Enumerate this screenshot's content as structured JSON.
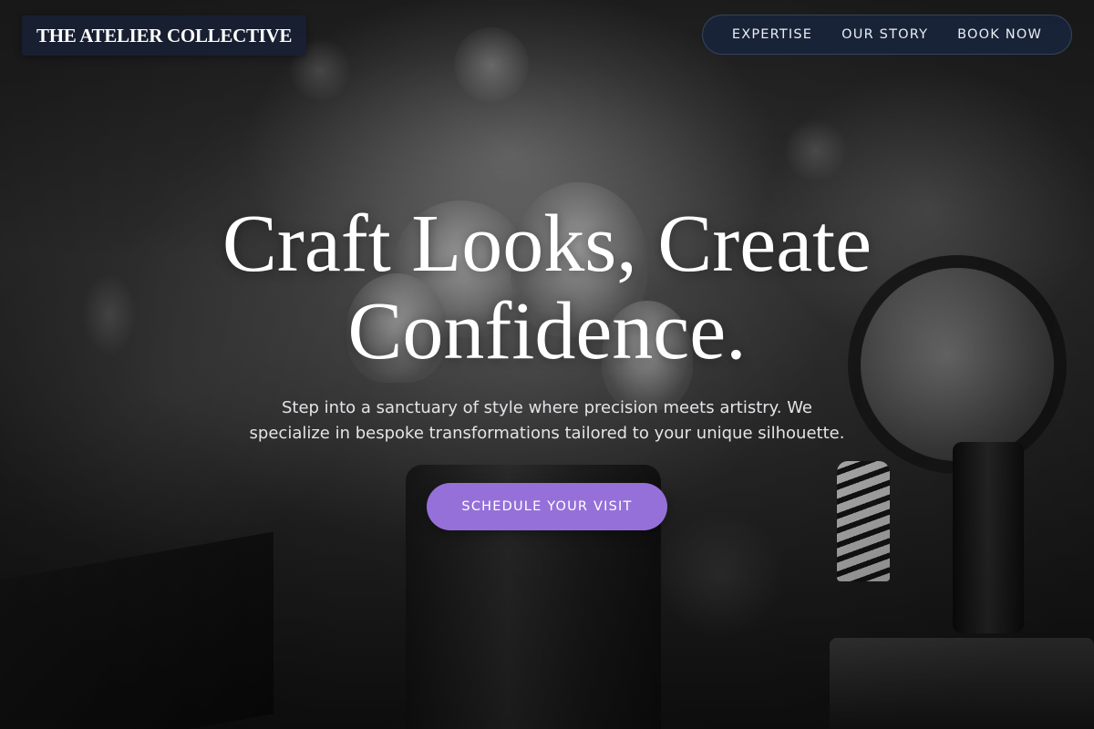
{
  "header": {
    "logo_text": "THE ATELIER COLLECTIVE",
    "nav": [
      {
        "label": "EXPERTISE"
      },
      {
        "label": "OUR STORY"
      },
      {
        "label": "BOOK NOW"
      }
    ]
  },
  "hero": {
    "headline_line1": "Craft Looks, Create",
    "headline_line2": "Confidence.",
    "subtext_line1": "Step into a sanctuary of style where precision meets artistry. We",
    "subtext_line2": "specialize in bespoke transformations tailored to your unique silhouette.",
    "cta_label": "SCHEDULE YOUR VISIT",
    "background_image": "makeup-brushes-photo"
  },
  "colors": {
    "cta": "#9570d9",
    "logo_bg": "#182034",
    "nav_bg": "#19243a",
    "text": "#ffffff"
  }
}
